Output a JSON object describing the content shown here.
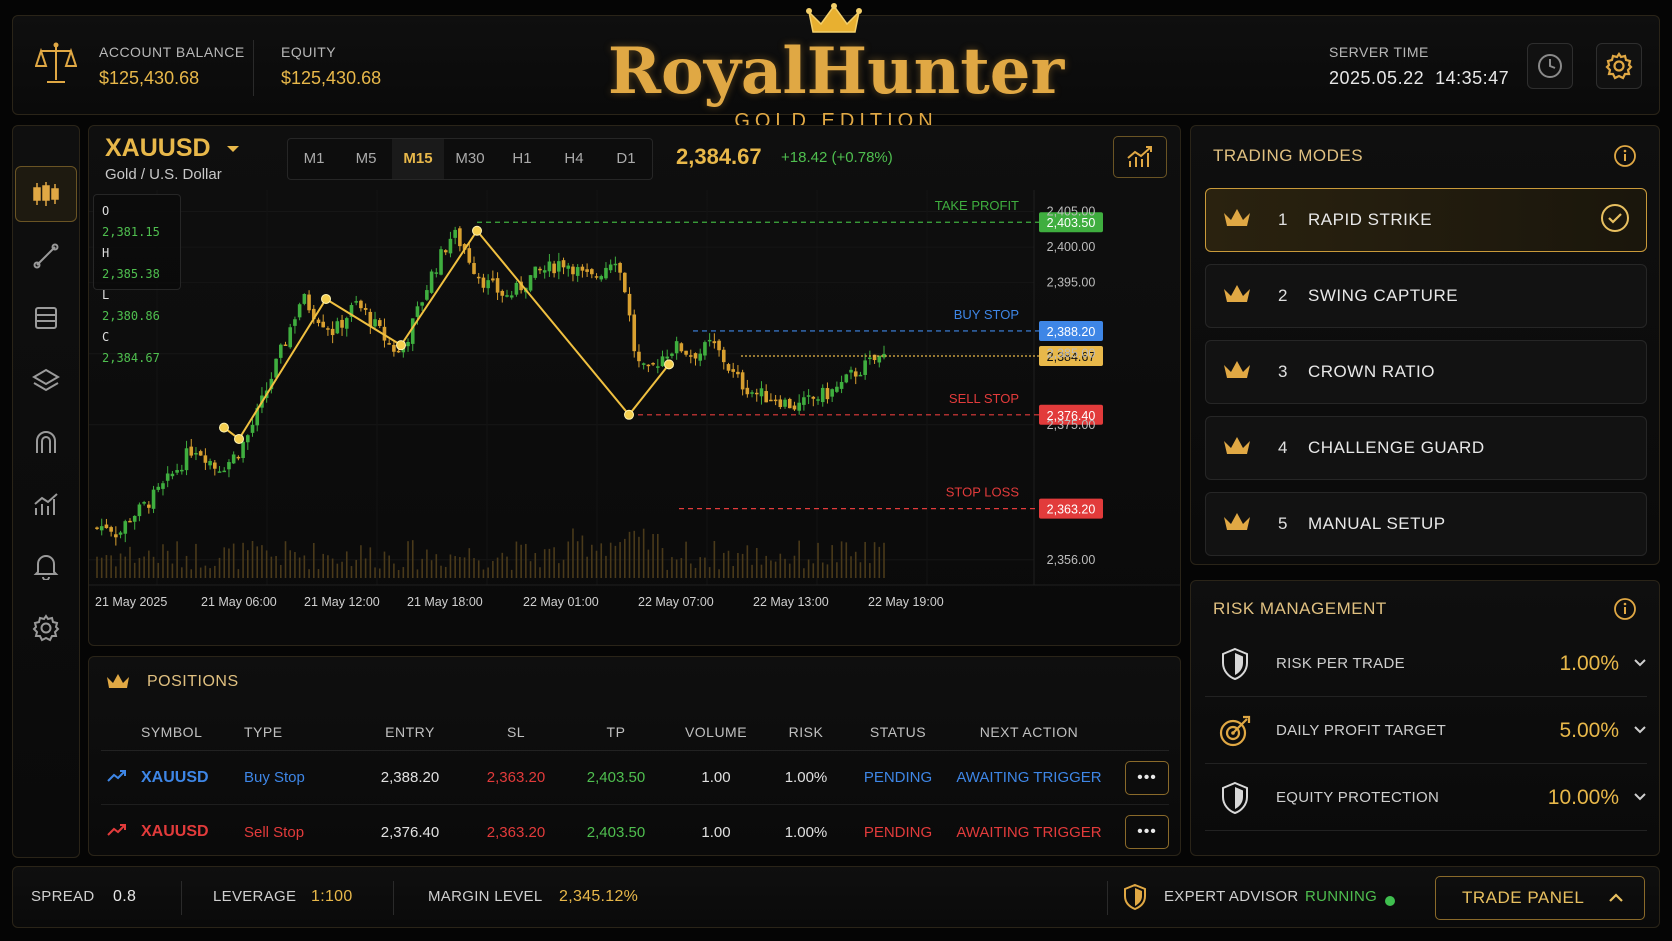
{
  "header": {
    "account_balance_label": "ACCOUNT BALANCE",
    "account_balance_value": "$125,430.68",
    "equity_label": "EQUITY",
    "equity_value": "$125,430.68",
    "brand_title": "RoyalHunter",
    "brand_subtitle": "GOLD EDITION",
    "server_time_label": "SERVER TIME",
    "server_time_value": "2025.05.22  14:35:47",
    "icons": [
      "scales-icon",
      "crown-icon",
      "clock-icon",
      "gear-icon"
    ]
  },
  "sidebar": {
    "items": [
      {
        "name": "candlestick-icon",
        "active": true
      },
      {
        "name": "trendline-icon",
        "active": false
      },
      {
        "name": "list-icon",
        "active": false
      },
      {
        "name": "layers-icon",
        "active": false
      },
      {
        "name": "magnet-icon",
        "active": false
      },
      {
        "name": "analytics-icon",
        "active": false
      },
      {
        "name": "bell-icon",
        "active": false
      },
      {
        "name": "gear-icon",
        "active": false
      }
    ]
  },
  "chart": {
    "symbol": "XAUUSD",
    "symbol_name": "Gold / U.S. Dollar",
    "timeframes": [
      "M1",
      "M5",
      "M15",
      "M30",
      "H1",
      "H4",
      "D1"
    ],
    "active_timeframe": "M15",
    "price": "2,384.67",
    "price_change": "+18.42 (+0.78%)",
    "ohlc": {
      "o_label": "O",
      "o_value": "2,381.15",
      "h_label": "H",
      "h_value": "2,385.38",
      "l_label": "L",
      "l_value": "2,380.86",
      "c_label": "C",
      "c_value": "2,384.67"
    },
    "y_ticks": [
      "2,405.00",
      "2,400.00",
      "2,395.00",
      "2,385.00",
      "2,375.00",
      "2,356.00"
    ],
    "x_ticks": [
      "21 May 2025",
      "21 May 06:00",
      "21 May 12:00",
      "21 May 18:00",
      "22 May 01:00",
      "22 May 07:00",
      "22 May 13:00",
      "22 May 19:00"
    ],
    "levels": [
      {
        "label": "TAKE PROFIT",
        "price": "2,403.50",
        "color": "#3fae3f"
      },
      {
        "label": "BUY STOP",
        "price": "2,388.20",
        "color": "#3e86e6"
      },
      {
        "label": "",
        "price": "2,384.67",
        "color": "#e8b84a"
      },
      {
        "label": "SELL STOP",
        "price": "2,376.40",
        "color": "#e23b3b"
      },
      {
        "label": "STOP LOSS",
        "price": "2,363.20",
        "color": "#e23b3b"
      }
    ]
  },
  "chart_data": {
    "type": "candlestick",
    "title": "",
    "xlabel": "",
    "ylabel": "",
    "ylim": [
      2353,
      2408
    ],
    "x_ticks": [
      "21 May 2025",
      "21 May 06:00",
      "21 May 12:00",
      "21 May 18:00",
      "22 May 01:00",
      "22 May 07:00",
      "22 May 13:00",
      "22 May 19:00"
    ],
    "close_path": [
      2360.5,
      2361,
      2359.5,
      2362,
      2363,
      2364.5,
      2366,
      2368,
      2370,
      2372,
      2370.8,
      2369,
      2369.5,
      2371,
      2373.5,
      2377,
      2381,
      2385,
      2389,
      2393,
      2391,
      2389.5,
      2388,
      2390,
      2392,
      2390.5,
      2388.5,
      2386.5,
      2385,
      2388,
      2392,
      2396,
      2399,
      2402,
      2400,
      2397,
      2395,
      2394,
      2393,
      2394,
      2395.5,
      2396.5,
      2397,
      2398,
      2397.5,
      2396,
      2395.5,
      2397,
      2399,
      2394,
      2384,
      2382,
      2384,
      2385.5,
      2386,
      2385,
      2385.2,
      2386.5,
      2384.5,
      2382,
      2380.5,
      2379.5,
      2379,
      2378.8,
      2378,
      2377.5,
      2378.3,
      2379,
      2379.5,
      2380.5,
      2382,
      2383,
      2384,
      2384.67
    ],
    "zigzag": [
      {
        "x": "21 May 04:30",
        "y": 2374.6
      },
      {
        "x": "21 May 05:30",
        "y": 2373.0
      },
      {
        "x": "21 May 09:30",
        "y": 2392.7
      },
      {
        "x": "21 May 11:30",
        "y": 2386.2
      },
      {
        "x": "21 May 15:30",
        "y": 2402.3
      },
      {
        "x": "22 May 03:30",
        "y": 2376.4
      },
      {
        "x": "22 May 06:30",
        "y": 2383.5
      }
    ]
  },
  "positions": {
    "title": "POSITIONS",
    "columns": [
      "SYMBOL",
      "TYPE",
      "ENTRY",
      "SL",
      "TP",
      "VOLUME",
      "RISK",
      "STATUS",
      "NEXT ACTION"
    ],
    "rows": [
      {
        "symbol": "XAUUSD",
        "type": "Buy Stop",
        "entry": "2,388.20",
        "sl": "2,363.20",
        "tp": "2,403.50",
        "volume": "1.00",
        "risk": "1.00%",
        "status": "PENDING",
        "next_action": "AWAITING TRIGGER",
        "color": "#3e86e6",
        "icon": "trend-up-icon"
      },
      {
        "symbol": "XAUUSD",
        "type": "Sell Stop",
        "entry": "2,376.40",
        "sl": "2,363.20",
        "tp": "2,403.50",
        "volume": "1.00",
        "risk": "1.00%",
        "status": "PENDING",
        "next_action": "AWAITING TRIGGER",
        "color": "#e23b3b",
        "icon": "trend-up-icon"
      }
    ],
    "more_label": "•••"
  },
  "modes": {
    "title": "TRADING MODES",
    "items": [
      {
        "num": "1",
        "label": "RAPID STRIKE",
        "active": true
      },
      {
        "num": "2",
        "label": "SWING CAPTURE",
        "active": false
      },
      {
        "num": "3",
        "label": "CROWN RATIO",
        "active": false
      },
      {
        "num": "4",
        "label": "CHALLENGE GUARD",
        "active": false
      },
      {
        "num": "5",
        "label": "MANUAL SETUP",
        "active": false
      }
    ]
  },
  "risk": {
    "title": "RISK MANAGEMENT",
    "items": [
      {
        "label": "RISK PER TRADE",
        "value": "1.00%",
        "icon": "shield-icon"
      },
      {
        "label": "DAILY PROFIT TARGET",
        "value": "5.00%",
        "icon": "target-icon"
      },
      {
        "label": "EQUITY PROTECTION",
        "value": "10.00%",
        "icon": "shield-icon"
      }
    ]
  },
  "footer": {
    "spread_label": "SPREAD",
    "spread_value": "0.8",
    "leverage_label": "LEVERAGE",
    "leverage_value": "1:100",
    "margin_label": "MARGIN LEVEL",
    "margin_value": "2,345.12%",
    "ea_label": "EXPERT ADVISOR",
    "ea_status": "RUNNING",
    "trade_panel_label": "TRADE PANEL"
  },
  "colors": {
    "gold": "#e8b84a",
    "green": "#4fbf4f",
    "red": "#e23b3b",
    "blue": "#3e86e6",
    "background": "#050505"
  }
}
